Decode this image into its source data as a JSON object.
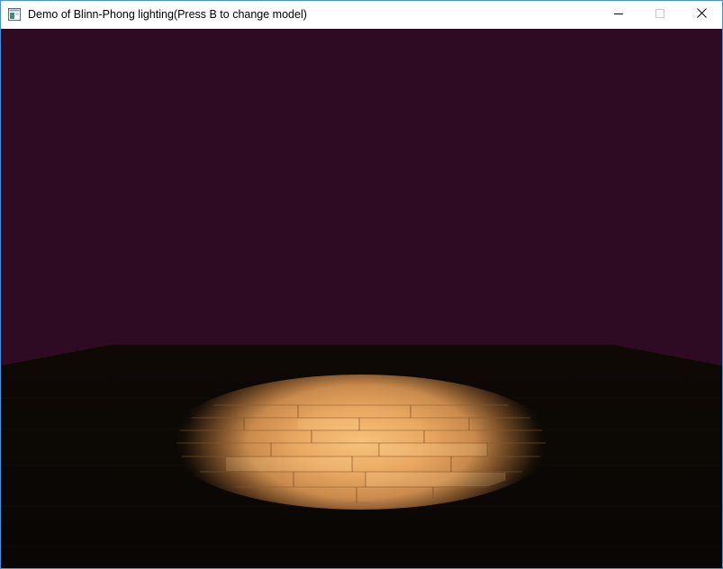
{
  "window": {
    "title": "Demo of Blinn-Phong lighting(Press B to change model)",
    "icon": "app-window-icon"
  },
  "controls": {
    "minimize_icon": "minimize-icon",
    "maximize_icon": "maximize-icon",
    "close_icon": "close-icon"
  },
  "scene": {
    "background_color": "#2f0a23",
    "floor_color": "#0b0704",
    "light_color": "#f3b66a"
  }
}
